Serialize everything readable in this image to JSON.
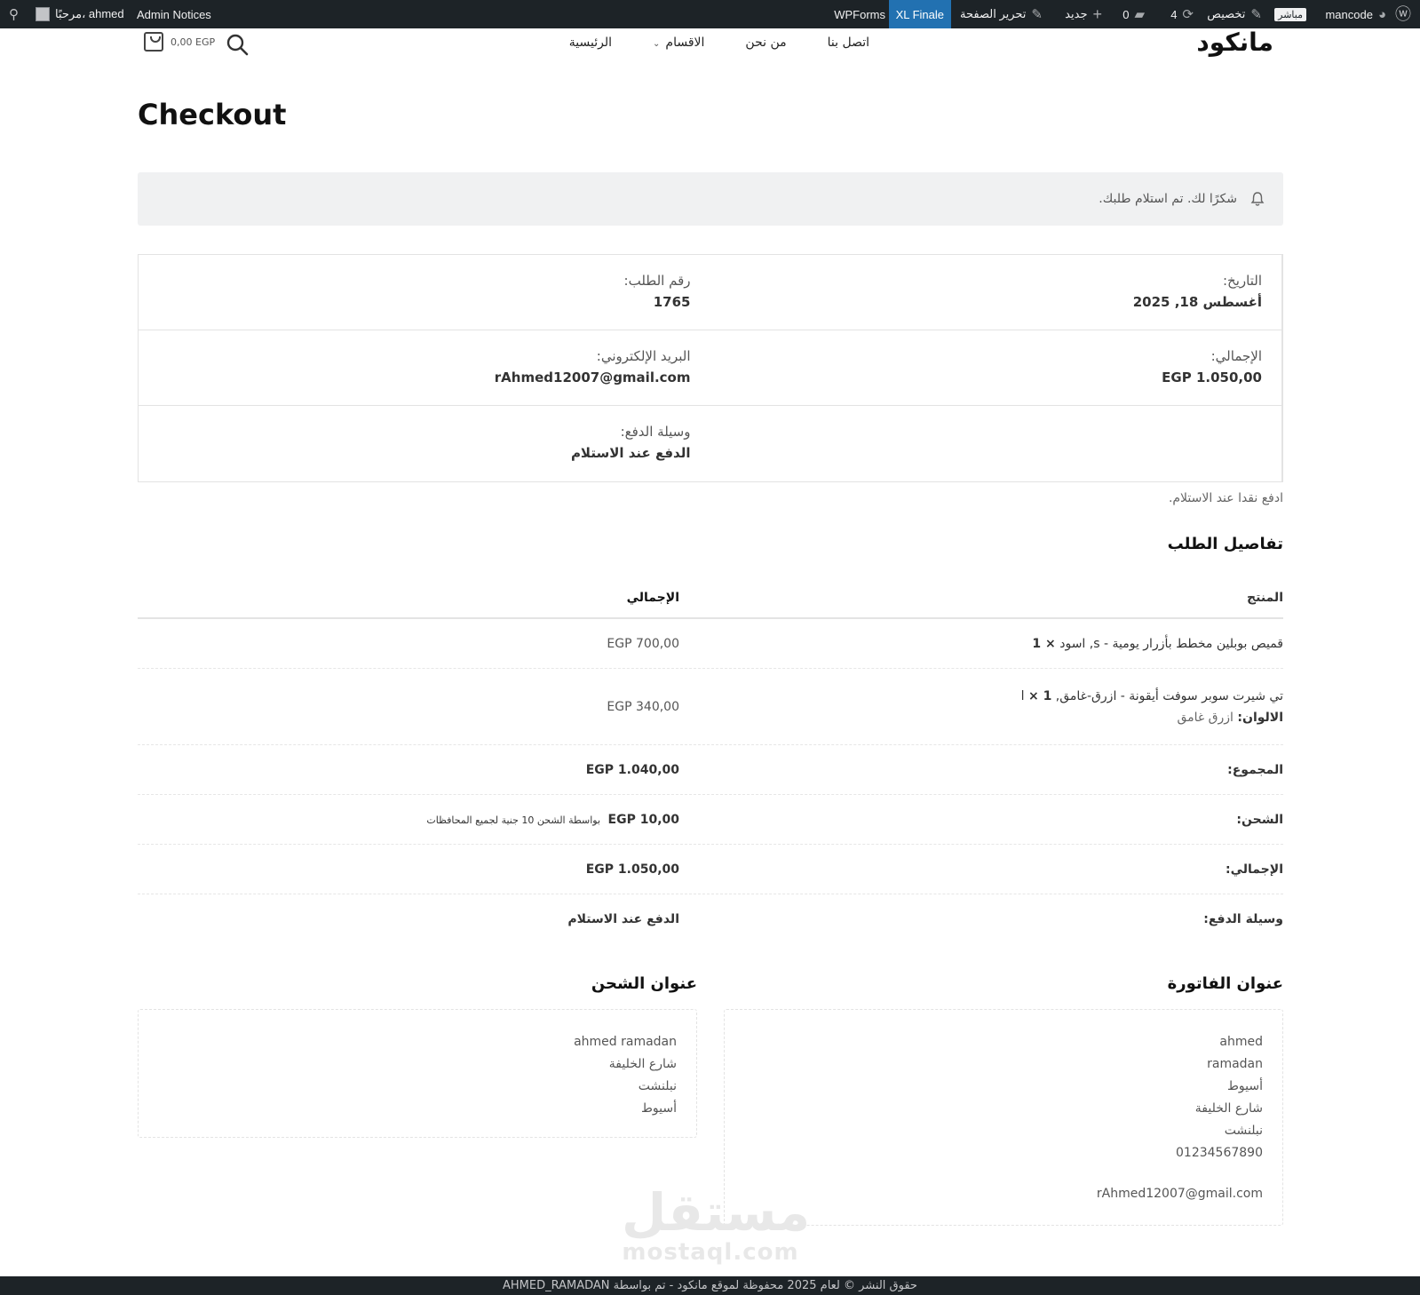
{
  "admin_bar": {
    "site_name": "mancode",
    "live_badge": "مباشر",
    "customize": "تخصيص",
    "updates_count": "4",
    "comments_count": "0",
    "new_label": "جديد",
    "edit_page": "تحرير الصفحة",
    "xl_finale": "XL Finale",
    "wpforms": "WPForms",
    "admin_notices": "Admin Notices",
    "greeting": "مرحبًا، ahmed"
  },
  "header": {
    "logo": "مانكود",
    "nav": [
      "الرئيسية",
      "الاقسام",
      "من نحن",
      "اتصل بنا"
    ],
    "cart_total": "0,00 EGP"
  },
  "page": {
    "title": "Checkout",
    "notice": "شكرًا لك. تم استلام طلبك."
  },
  "overview": {
    "order_number_label": "رقم الطلب:",
    "order_number": "1765",
    "date_label": "التاريخ:",
    "date": "أغسطس 18, 2025",
    "email_label": "البريد الإلكتروني:",
    "email": "rAhmed12007@gmail.com",
    "total_label": "الإجمالي:",
    "total": "1.050,00 EGP",
    "payment_label": "وسيلة الدفع:",
    "payment": "الدفع عند الاستلام"
  },
  "payment_note": "ادفع نقدا عند الاستلام.",
  "order_details": {
    "heading": "تفاصيل الطلب",
    "col_product": "المنتج",
    "col_total": "الإجمالي",
    "items": [
      {
        "name": "قميص بوبلين مخطط بأزرار يومية - s, اسود",
        "qty": "× 1",
        "total": "700,00 EGP"
      },
      {
        "name": "تي شيرت سوبر سوفت أيقونة - ازرق-غامق, l",
        "qty": "× 1",
        "meta_label": "الالوان:",
        "meta_value": "ازرق غامق",
        "total": "340,00 EGP"
      }
    ],
    "subtotal_label": "المجموع:",
    "subtotal": "EGP 1.040,00",
    "shipping_label": "الشحن:",
    "shipping": "EGP 10,00",
    "shipping_method": "بواسطة الشحن 10 جنية لجميع المحافظات",
    "total_label": "الإجمالي:",
    "total": "EGP 1.050,00",
    "payment_label": "وسيلة الدفع:",
    "payment": "الدفع عند الاستلام"
  },
  "billing": {
    "heading": "عنوان الفاتورة",
    "lines": [
      "ahmed",
      "ramadan",
      "أسيوط",
      "شارع الخليفة",
      "نبلنشت",
      "01234567890"
    ],
    "email": "rAhmed12007@gmail.com"
  },
  "shipping_address": {
    "heading": "عنوان الشحن",
    "lines": [
      "ahmed ramadan",
      "شارع الخليفة",
      "نبلنشت",
      "أسيوط"
    ]
  },
  "watermark": {
    "ar": "مستقل",
    "en": "mostaql.com"
  },
  "footer": "حقوق النشر © لعام 2025 محفوظة لموقع مانكود - تم بواسطة AHMED_RAMADAN"
}
